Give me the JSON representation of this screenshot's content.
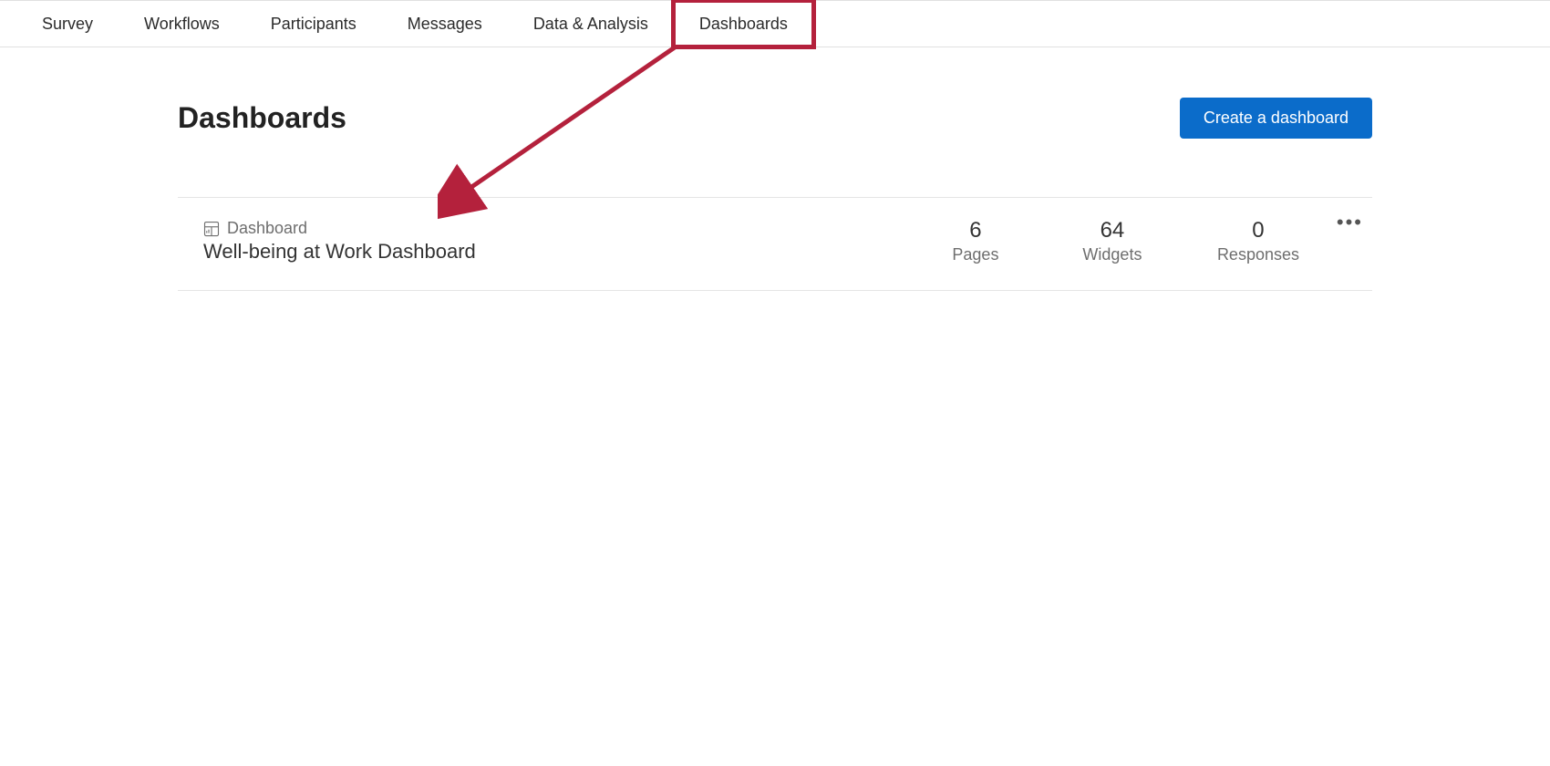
{
  "nav": {
    "tabs": [
      {
        "label": "Survey"
      },
      {
        "label": "Workflows"
      },
      {
        "label": "Participants"
      },
      {
        "label": "Messages"
      },
      {
        "label": "Data & Analysis"
      },
      {
        "label": "Dashboards"
      }
    ],
    "highlighted_index": 5
  },
  "page": {
    "title": "Dashboards",
    "create_label": "Create a dashboard"
  },
  "dashboards": [
    {
      "type_label": "Dashboard",
      "name": "Well-being at Work Dashboard",
      "stats": {
        "pages": {
          "value": "6",
          "label": "Pages"
        },
        "widgets": {
          "value": "64",
          "label": "Widgets"
        },
        "responses": {
          "value": "0",
          "label": "Responses"
        }
      }
    }
  ]
}
